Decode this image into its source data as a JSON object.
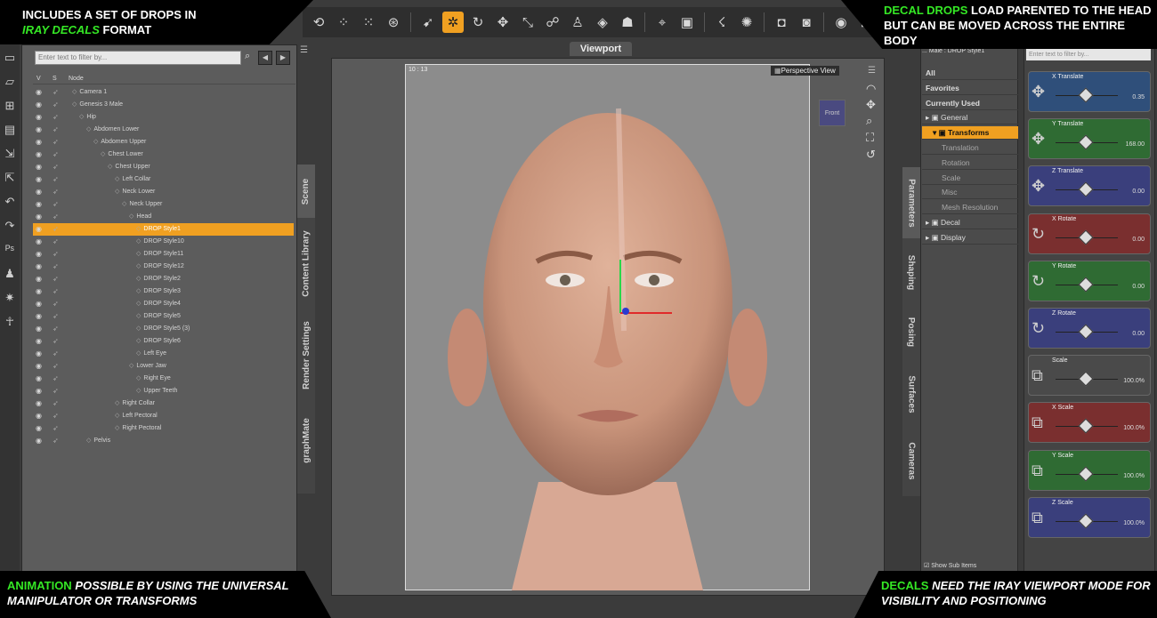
{
  "banners": {
    "top_left": {
      "line1": "INCLUDES A SET OF DROPS IN",
      "hl": "IRAY DECALS",
      "rest": " FORMAT"
    },
    "top_right": {
      "hl": "DECAL DROPS",
      "rest": " LOAD PARENTED TO THE HEAD BUT CAN BE MOVED ACROSS THE ENTIRE BODY"
    },
    "bottom_left": {
      "hl": "ANIMATION",
      "rest": "  POSSIBLE BY USING THE UNIVERSAL MANIPULATOR OR TRANSFORMS"
    },
    "bottom_right": {
      "hl": "DECALS",
      "rest": " NEED THE IRAY VIEWPORT MODE FOR VISIBILITY AND POSITIONING"
    }
  },
  "scene": {
    "filter_placeholder": "Enter text to filter by...",
    "col_v": "V",
    "col_s": "S",
    "col_node": "Node",
    "nodes": [
      {
        "label": "Camera 1",
        "depth": 0
      },
      {
        "label": "Genesis 3 Male",
        "depth": 0
      },
      {
        "label": "Hip",
        "depth": 1
      },
      {
        "label": "Abdomen Lower",
        "depth": 2
      },
      {
        "label": "Abdomen Upper",
        "depth": 3
      },
      {
        "label": "Chest Lower",
        "depth": 4
      },
      {
        "label": "Chest Upper",
        "depth": 5
      },
      {
        "label": "Left Collar",
        "depth": 6
      },
      {
        "label": "Neck Lower",
        "depth": 6
      },
      {
        "label": "Neck Upper",
        "depth": 7
      },
      {
        "label": "Head",
        "depth": 8
      },
      {
        "label": "DROP Style1",
        "depth": 9,
        "selected": true
      },
      {
        "label": "DROP Style10",
        "depth": 9
      },
      {
        "label": "DROP Style11",
        "depth": 9
      },
      {
        "label": "DROP Style12",
        "depth": 9
      },
      {
        "label": "DROP Style2",
        "depth": 9
      },
      {
        "label": "DROP Style3",
        "depth": 9
      },
      {
        "label": "DROP Style4",
        "depth": 9
      },
      {
        "label": "DROP Style5",
        "depth": 9
      },
      {
        "label": "DROP Style5 (3)",
        "depth": 9
      },
      {
        "label": "DROP Style6",
        "depth": 9
      },
      {
        "label": "Left Eye",
        "depth": 9
      },
      {
        "label": "Lower Jaw",
        "depth": 8
      },
      {
        "label": "Right Eye",
        "depth": 9
      },
      {
        "label": "Upper Teeth",
        "depth": 9
      },
      {
        "label": "Right Collar",
        "depth": 6
      },
      {
        "label": "Left Pectoral",
        "depth": 6
      },
      {
        "label": "Right Pectoral",
        "depth": 6
      },
      {
        "label": "Pelvis",
        "depth": 2
      }
    ]
  },
  "left_tabs": [
    "Scene",
    "Content Library",
    "Render Settings",
    "graphMate"
  ],
  "viewport": {
    "tab": "Viewport",
    "time": "10 : 13",
    "view_mode": "Perspective View",
    "cube_label": "Front"
  },
  "parameters": {
    "breadcrumb": "... Male : DROP Style1",
    "filter_placeholder": "Enter text to filter by...",
    "list": [
      {
        "label": "All",
        "style": "bold"
      },
      {
        "label": "Favorites",
        "style": "bold"
      },
      {
        "label": "Currently Used",
        "style": "bold"
      },
      {
        "label": "General",
        "style": "group"
      },
      {
        "label": "Transforms",
        "style": "sel"
      },
      {
        "label": "Translation",
        "style": "dim"
      },
      {
        "label": "Rotation",
        "style": "dim"
      },
      {
        "label": "Scale",
        "style": "dim"
      },
      {
        "label": "Misc",
        "style": "dim"
      },
      {
        "label": "Mesh Resolution",
        "style": "dim"
      },
      {
        "label": "Decal",
        "style": "group"
      },
      {
        "label": "Display",
        "style": "group"
      }
    ],
    "show_sub_items": "Show Sub Items",
    "sliders": [
      {
        "name": "X Translate",
        "value": "0.35",
        "color": "#2f4f7a"
      },
      {
        "name": "Y Translate",
        "value": "168.00",
        "color": "#2f6b33"
      },
      {
        "name": "Z Translate",
        "value": "0.00",
        "color": "#3a3f7c"
      },
      {
        "name": "X Rotate",
        "value": "0.00",
        "color": "#7a2f2f"
      },
      {
        "name": "Y Rotate",
        "value": "0.00",
        "color": "#2f6b33"
      },
      {
        "name": "Z Rotate",
        "value": "0.00",
        "color": "#3a3f7c"
      },
      {
        "name": "Scale",
        "value": "100.0%",
        "color": "#4a4a4a"
      },
      {
        "name": "X Scale",
        "value": "100.0%",
        "color": "#7a2f2f"
      },
      {
        "name": "Y Scale",
        "value": "100.0%",
        "color": "#2f6b33"
      },
      {
        "name": "Z Scale",
        "value": "100.0%",
        "color": "#3a3f7c"
      }
    ]
  },
  "right_tabs": [
    "Parameters",
    "Shaping",
    "Posing",
    "Surfaces",
    "Cameras"
  ],
  "colors": {
    "accent": "#f0a021",
    "highlight_text": "#35e825"
  }
}
